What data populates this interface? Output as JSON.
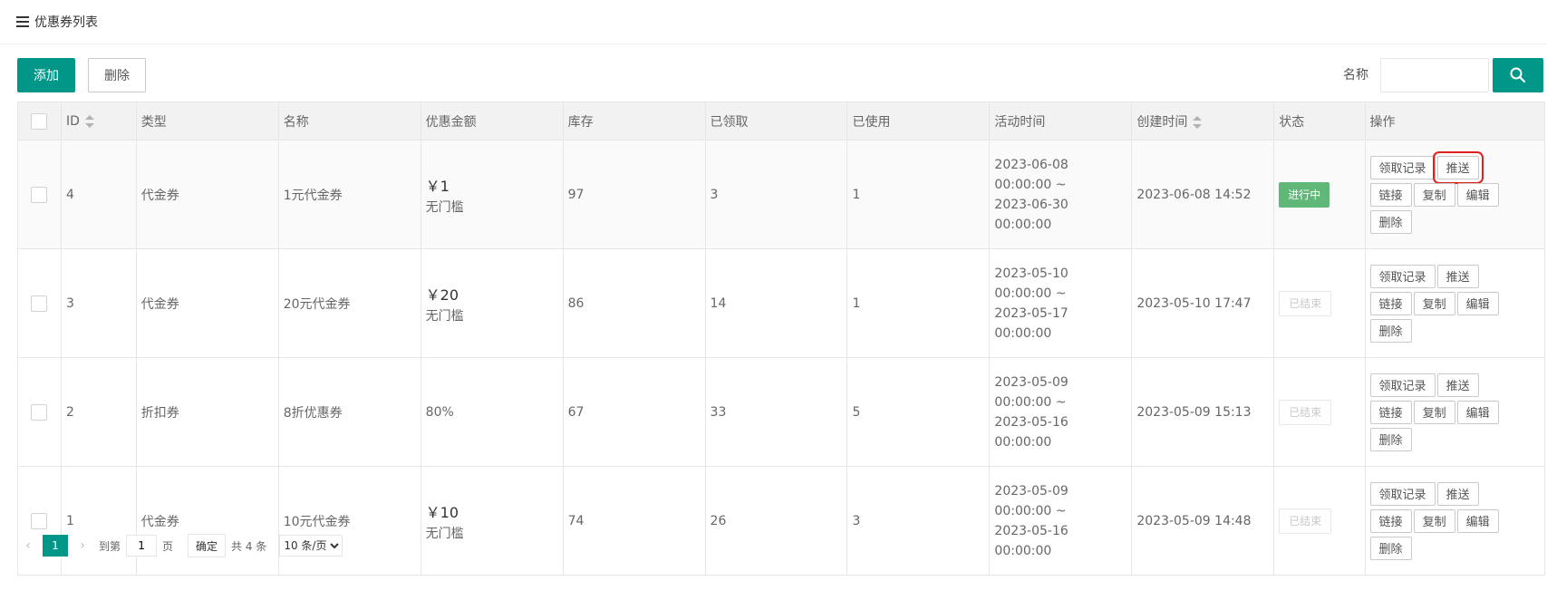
{
  "page": {
    "title": "优惠券列表"
  },
  "toolbar": {
    "add_label": "添加",
    "delete_label": "删除",
    "search_label": "名称",
    "search_value": "",
    "search_placeholder": ""
  },
  "table": {
    "headers": {
      "id": "ID",
      "type": "类型",
      "name": "名称",
      "amount": "优惠金额",
      "stock": "库存",
      "claimed": "已领取",
      "used": "已使用",
      "period": "活动时间",
      "created": "创建时间",
      "status": "状态",
      "actions": "操作"
    },
    "actions": {
      "records": "领取记录",
      "push": "推送",
      "link": "链接",
      "copy": "复制",
      "edit": "编辑",
      "delete": "删除"
    },
    "rows": [
      {
        "id": "4",
        "type": "代金券",
        "name": "1元代金券",
        "amount": "￥1",
        "amount_sub": "无门槛",
        "stock": "97",
        "claimed": "3",
        "used": "1",
        "start": "2023-06-08 00:00:00 ~",
        "end": "2023-06-30 00:00:00",
        "created": "2023-06-08 14:52",
        "status": "进行中"
      },
      {
        "id": "3",
        "type": "代金券",
        "name": "20元代金券",
        "amount": "￥20",
        "amount_sub": "无门槛",
        "stock": "86",
        "claimed": "14",
        "used": "1",
        "start": "2023-05-10 00:00:00 ~",
        "end": "2023-05-17 00:00:00",
        "created": "2023-05-10 17:47",
        "status": "已结束"
      },
      {
        "id": "2",
        "type": "折扣券",
        "name": "8折优惠券",
        "amount": "80%",
        "amount_sub": "",
        "stock": "67",
        "claimed": "33",
        "used": "5",
        "start": "2023-05-09 00:00:00 ~",
        "end": "2023-05-16 00:00:00",
        "created": "2023-05-09 15:13",
        "status": "已结束"
      },
      {
        "id": "1",
        "type": "代金券",
        "name": "10元代金券",
        "amount": "￥10",
        "amount_sub": "无门槛",
        "stock": "74",
        "claimed": "26",
        "used": "3",
        "start": "2023-05-09 00:00:00 ~",
        "end": "2023-05-16 00:00:00",
        "created": "2023-05-09 14:48",
        "status": "已结束"
      }
    ]
  },
  "pager": {
    "current": "1",
    "goto_prefix": "到第",
    "goto_value": "1",
    "goto_suffix": "页",
    "confirm": "确定",
    "total": "共 4 条",
    "page_size": "10 条/页"
  },
  "colors": {
    "primary": "#009688",
    "active_status": "#5FB878",
    "highlight": "#e0201c"
  }
}
